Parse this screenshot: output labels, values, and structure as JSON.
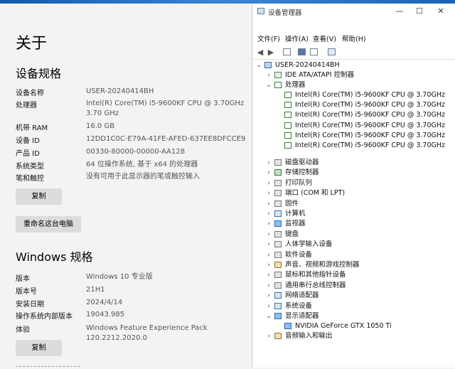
{
  "about": {
    "title": "关于",
    "device_spec": {
      "heading": "设备规格",
      "rows": [
        {
          "key": "设备名称",
          "value": "USER-20240414BH"
        },
        {
          "key": "处理器",
          "value": "Intel(R) Core(TM) i5-9600KF CPU @ 3.70GHz   3.70 GHz"
        },
        {
          "key": "机带 RAM",
          "value": "16.0 GB"
        },
        {
          "key": "设备 ID",
          "value": "12DD1C0C-E79A-41FE-AFED-637EE8DFCCE9"
        },
        {
          "key": "产品 ID",
          "value": "00330-80000-00000-AA128"
        },
        {
          "key": "系统类型",
          "value": "64 位操作系统, 基于 x64 的处理器"
        },
        {
          "key": "笔和触控",
          "value": "没有可用于此显示器的笔或触控输入"
        }
      ],
      "copy_label": "复制",
      "rename_label": "重命名这台电脑"
    },
    "windows_spec": {
      "heading": "Windows 规格",
      "rows": [
        {
          "key": "版本",
          "value": "Windows 10 专业版"
        },
        {
          "key": "版本号",
          "value": "21H1"
        },
        {
          "key": "安装日期",
          "value": "2024/4/14"
        },
        {
          "key": "操作系统内部版本",
          "value": "19043.985"
        },
        {
          "key": "体验",
          "value": "Windows Feature Experience Pack 120.2212.2020.0"
        }
      ],
      "copy_label": "复制"
    }
  },
  "device_manager": {
    "title": "设备管理器",
    "window_buttons": {
      "minimize": "—",
      "maximize": "☐",
      "close": "✕"
    },
    "menu": [
      "文件(F)",
      "操作(A)",
      "查看(V)",
      "帮助(H)"
    ],
    "tree": {
      "root": "USER-20240414BH",
      "ide": "IDE ATA/ATAPI 控制器",
      "processors": "处理器",
      "cpus": [
        "Intel(R) Core(TM) i5-9600KF CPU @ 3.70GHz",
        "Intel(R) Core(TM) i5-9600KF CPU @ 3.70GHz",
        "Intel(R) Core(TM) i5-9600KF CPU @ 3.70GHz",
        "Intel(R) Core(TM) i5-9600KF CPU @ 3.70GHz",
        "Intel(R) Core(TM) i5-9600KF CPU @ 3.70GHz",
        "Intel(R) Core(TM) i5-9600KF CPU @ 3.70GHz"
      ],
      "categories": [
        "磁盘驱动器",
        "存储控制器",
        "打印队列",
        "端口 (COM 和 LPT)",
        "固件",
        "计算机",
        "监视器",
        "键盘",
        "人体学输入设备",
        "软件设备",
        "声音、视频和游戏控制器",
        "鼠标和其他指针设备",
        "通用串行总线控制器",
        "网络适配器",
        "系统设备"
      ],
      "display_adapters": "显示适配器",
      "gpu": "NVIDIA GeForce GTX 1050 Ti",
      "audio": "音频输入和输出"
    }
  }
}
